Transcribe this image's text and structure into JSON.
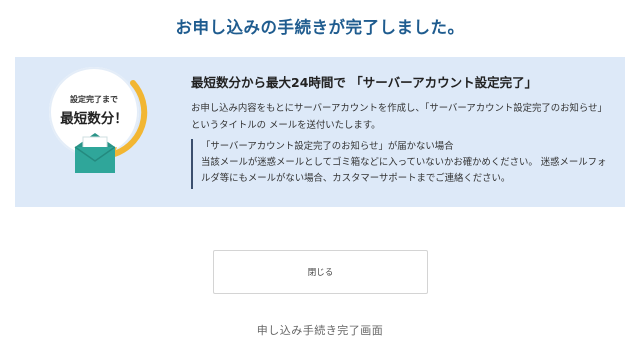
{
  "header": {
    "title": "お申し込みの手続きが完了しました。"
  },
  "badge": {
    "line1": "設定完了まで",
    "line2": "最短数分！"
  },
  "panel": {
    "headline": "最短数分から最大24時間で 「サーバーアカウント設定完了」",
    "body": "お申し込み内容をもとにサーバーアカウントを作成し、「サーバーアカウント設定完了のお知らせ」というタイトルの メールを送付いたします。",
    "notice_title": "「サーバーアカウント設定完了のお知らせ」が届かない場合",
    "notice_body": "当該メールが迷惑メールとしてゴミ箱などに入っていないかお確かめください。 迷惑メールフォルダ等にもメールがない場合、カスタマーサポートまでご連絡ください。"
  },
  "actions": {
    "close_label": "閉じる"
  },
  "caption": "申し込み手続き完了画面",
  "colors": {
    "title": "#1f5c8f",
    "panel_bg": "#dde9f8",
    "accent_ring": "#f2b632",
    "envelope": "#2fa69a"
  }
}
